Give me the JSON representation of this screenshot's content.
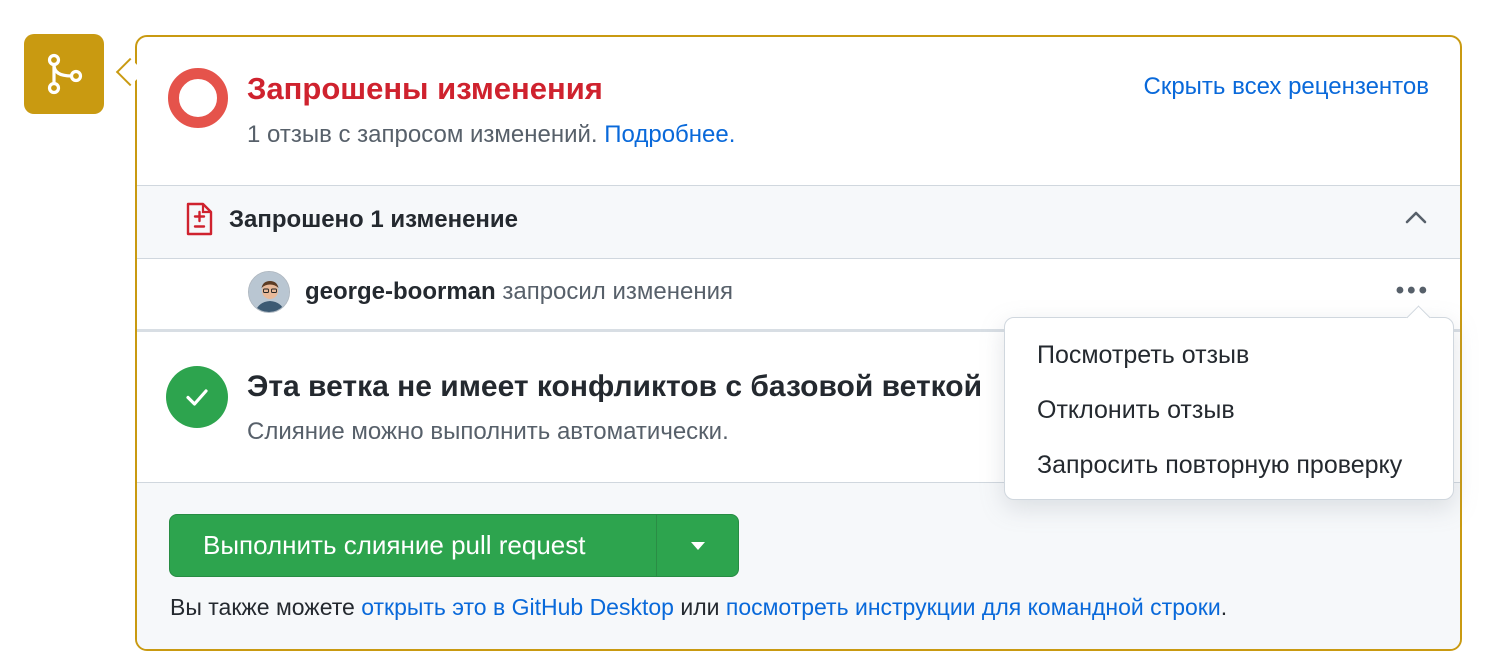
{
  "review": {
    "title": "Запрошены изменения",
    "subtitle": "1 отзыв с запросом изменений.",
    "learn_more": "Подробнее.",
    "hide_reviewers": "Скрыть всех рецензентов"
  },
  "changes": {
    "title": "Запрошено 1 изменение",
    "reviewer_name": "george-boorman",
    "reviewer_action": "запросил изменения",
    "more_label": "•••"
  },
  "conflicts": {
    "title": "Эта ветка не имеет конфликтов с базовой веткой",
    "subtitle": "Слияние можно выполнить автоматически."
  },
  "merge": {
    "button_label": "Выполнить слияние pull request",
    "hint_prefix": "Вы также можете",
    "desktop_link": "открыть это в GitHub Desktop",
    "hint_or": "или",
    "cli_link": "посмотреть инструкции для командной строки",
    "hint_suffix": "."
  },
  "menu": {
    "items": [
      "Посмотреть отзыв",
      "Отклонить отзыв",
      "Запросить повторную проверку"
    ]
  },
  "colors": {
    "accent": "#c99a11",
    "danger": "#cf222e",
    "success": "#2da44e",
    "link": "#0969da"
  },
  "icons": [
    "git-merge-icon",
    "changes-requested-icon",
    "file-diff-icon",
    "chevron-up-icon",
    "kebab-menu-icon",
    "check-icon",
    "triangle-down-icon"
  ]
}
